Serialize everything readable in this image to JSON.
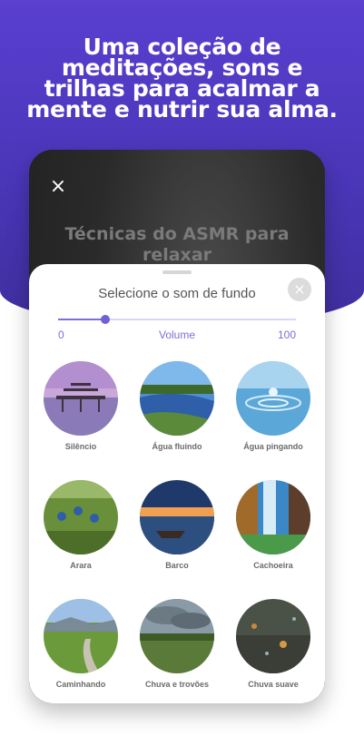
{
  "headline": "Uma coleção de\nmeditações, sons e\ntrilhas para acalmar a\nmente e nutrir sua alma.",
  "phone": {
    "close_icon": "×",
    "title": "Técnicas do ASMR para relaxar"
  },
  "sheet": {
    "title": "Selecione o som de fundo",
    "close_icon": "×",
    "volume": {
      "min_label": "0",
      "label": "Volume",
      "max_label": "100",
      "value": 20
    },
    "sounds": [
      {
        "label": "Silêncio",
        "icon": "pier-sunset-image"
      },
      {
        "label": "Água fluindo",
        "icon": "river-image"
      },
      {
        "label": "Água pingando",
        "icon": "water-drop-image"
      },
      {
        "label": "Arara",
        "icon": "birds-image"
      },
      {
        "label": "Barco",
        "icon": "boat-image"
      },
      {
        "label": "Cachoeira",
        "icon": "waterfall-image"
      },
      {
        "label": "Caminhando",
        "icon": "path-image"
      },
      {
        "label": "Chuva e trovões",
        "icon": "storm-image"
      },
      {
        "label": "Chuva suave",
        "icon": "rain-window-image"
      }
    ]
  },
  "colors": {
    "brand": "#5a3fd0",
    "accent": "#7c6fd8"
  }
}
